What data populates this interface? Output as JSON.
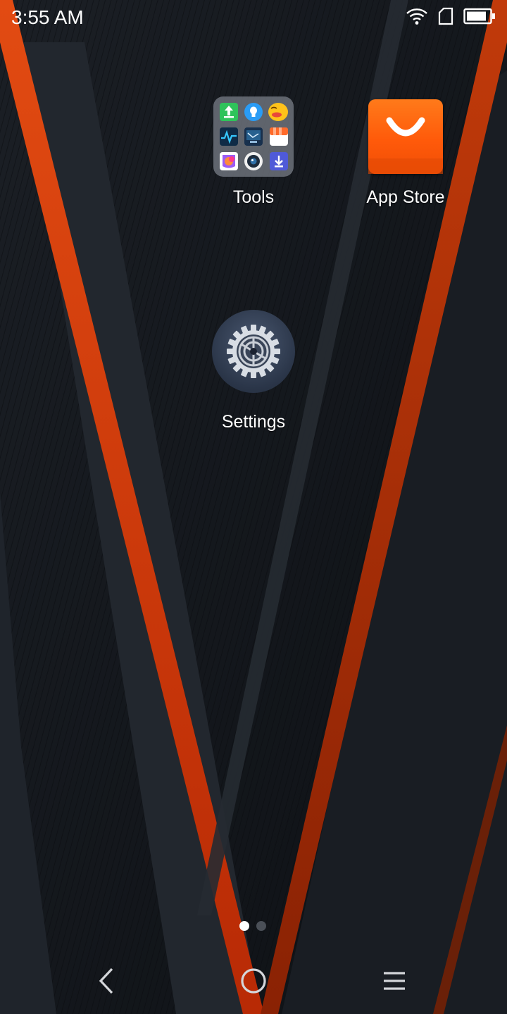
{
  "status_bar": {
    "time": "3:55 AM",
    "icons": [
      "wifi-icon",
      "sim-card-icon",
      "battery-icon"
    ]
  },
  "apps": [
    {
      "id": "tools",
      "label": "Tools",
      "icon": "folder-icon"
    },
    {
      "id": "app_store",
      "label": "App Store",
      "icon": "shopping-bag-icon"
    },
    {
      "id": "settings",
      "label": "Settings",
      "icon": "gear-icon"
    }
  ],
  "tools_folder_icons": [
    "upload-icon",
    "lightbulb-icon",
    "emoji-icon",
    "activity-icon",
    "screen-recorder-icon",
    "store-icon",
    "theme-icon",
    "camera-icon",
    "download-icon"
  ],
  "page_indicator": {
    "count": 2,
    "active_index": 0
  },
  "navbar": {
    "buttons": [
      "back-icon",
      "home-icon",
      "menu-icon"
    ]
  },
  "colors": {
    "accent_orange": "#e2450f",
    "app_store_orange": "#ff6a10",
    "wallpaper_dark": "#121519"
  }
}
